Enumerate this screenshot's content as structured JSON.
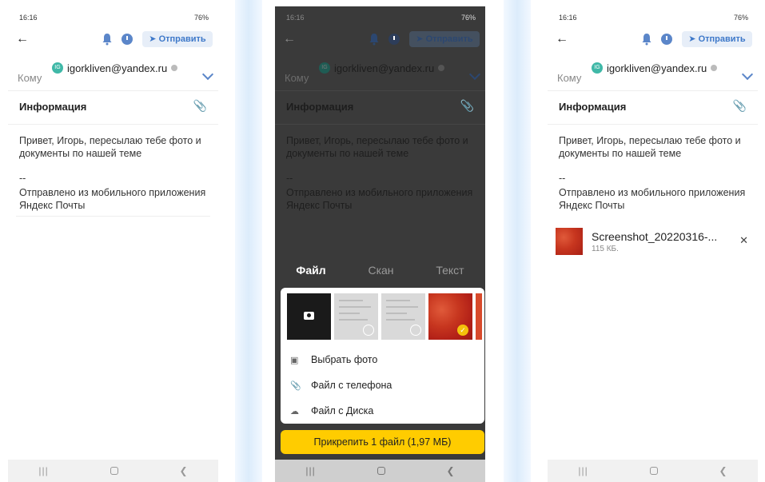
{
  "status": {
    "time": "16:16",
    "battery": "76%"
  },
  "toolbar": {
    "send_label": "Отправить"
  },
  "compose": {
    "to_label": "Кому",
    "recipient": "igorkliven@yandex.ru",
    "recipient_initials": "IG",
    "subject": "Информация",
    "body": "Привет, Игорь, пересылаю тебе фото и документы по нашей теме",
    "sig_dash": "--",
    "signature": "Отправлено из мобильного приложения Яндекс Почты"
  },
  "picker": {
    "tabs": [
      {
        "label": "Файл",
        "active": true
      },
      {
        "label": "Скан",
        "active": false
      },
      {
        "label": "Текст",
        "active": false
      }
    ],
    "options": [
      {
        "label": "Выбрать фото",
        "icon": "image-icon"
      },
      {
        "label": "Файл с телефона",
        "icon": "paperclip-icon"
      },
      {
        "label": "Файл с Диска",
        "icon": "cloud-disk-icon"
      }
    ],
    "attach_button": "Прикрепить 1 файл (1,97 МБ)"
  },
  "attachment": {
    "name": "Screenshot_20220316-...",
    "size": "115 КБ."
  },
  "colors": {
    "accent": "#3d78c9",
    "yellow": "#ffcc00",
    "avatar": "#3fb8a7"
  }
}
